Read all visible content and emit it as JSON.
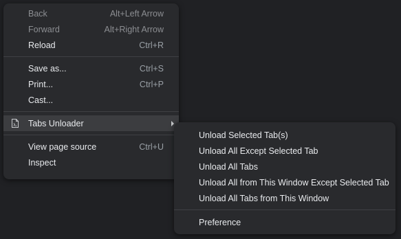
{
  "context_menu": {
    "items": [
      {
        "label": "Back",
        "accel": "Alt+Left Arrow"
      },
      {
        "label": "Forward",
        "accel": "Alt+Right Arrow"
      },
      {
        "label": "Reload",
        "accel": "Ctrl+R"
      },
      {
        "label": "Save as...",
        "accel": "Ctrl+S"
      },
      {
        "label": "Print...",
        "accel": "Ctrl+P"
      },
      {
        "label": "Cast..."
      },
      {
        "label": "Tabs Unloader",
        "icon": "tabs-unloader-extension-icon"
      },
      {
        "label": "View page source",
        "accel": "Ctrl+U"
      },
      {
        "label": "Inspect"
      }
    ]
  },
  "submenu": {
    "items": [
      {
        "label": "Unload Selected Tab(s)"
      },
      {
        "label": "Unload All Except Selected Tab"
      },
      {
        "label": "Unload All Tabs"
      },
      {
        "label": "Unload All from This Window Except Selected Tab"
      },
      {
        "label": "Unload All Tabs from This Window"
      },
      {
        "label": "Preference"
      }
    ]
  },
  "colors": {
    "background": "#202124",
    "menu_bg": "#292a2d",
    "text": "#e8eaed",
    "disabled_text": "#8c8e92",
    "highlight": "#3c3d40"
  }
}
